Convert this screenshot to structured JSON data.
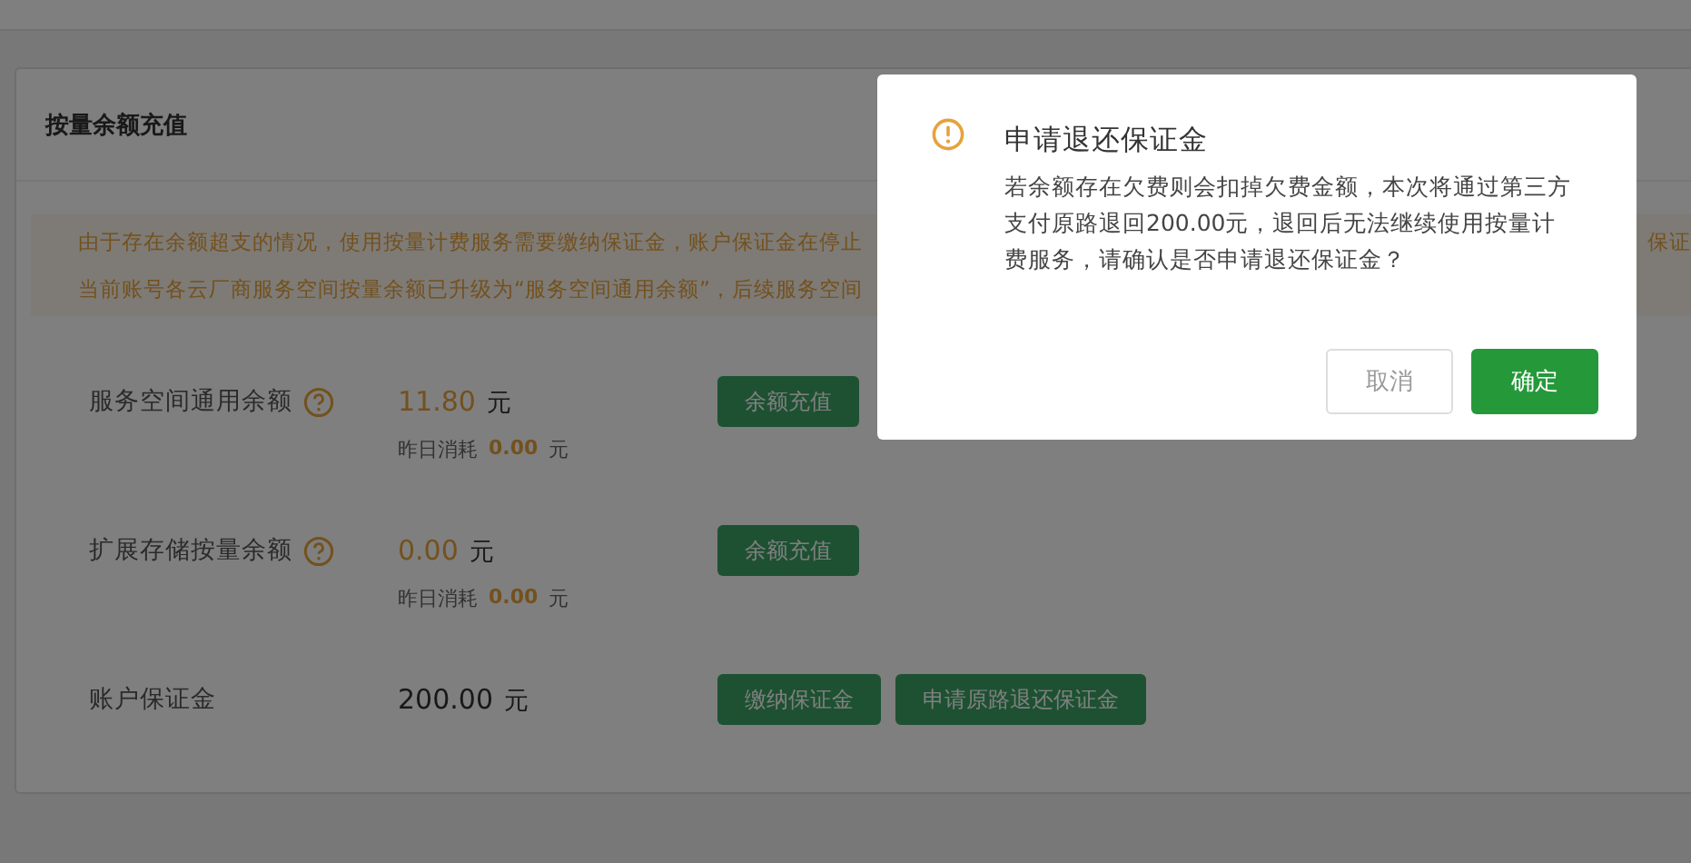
{
  "card": {
    "title": "按量余额充值"
  },
  "notice": {
    "lines": [
      {
        "text": "由于存在余额超支的情况，使用按量计费服务需要缴纳保证金，账户保证金在停止",
        "tail": "保证"
      },
      {
        "text": "当前账号各云厂商服务空间按量余额已升级为“服务空间通用余额”，后续服务空间"
      }
    ]
  },
  "rows": [
    {
      "label": "服务空间通用余额",
      "help": true,
      "amount": "11.80",
      "highlight": true,
      "unit": "元",
      "buttons": [
        "余额充值"
      ],
      "yesterday": {
        "label": "昨日消耗",
        "amount": "0.00",
        "unit": "元"
      }
    },
    {
      "label": "扩展存储按量余额",
      "help": true,
      "amount": "0.00",
      "highlight": true,
      "unit": "元",
      "buttons": [
        "余额充值"
      ],
      "yesterday": {
        "label": "昨日消耗",
        "amount": "0.00",
        "unit": "元"
      }
    },
    {
      "label": "账户保证金",
      "help": false,
      "amount": "200.00",
      "highlight": false,
      "unit": "元",
      "buttons": [
        "缴纳保证金",
        "申请原路退还保证金"
      ]
    }
  ],
  "dialog": {
    "title": "申请退还保证金",
    "message": "若余额存在欠费则会扣掉欠费金额，本次将通过第三方支付原路退回200.00元，退回后无法继续使用按量计费服务，请确认是否申请退还保证金？",
    "cancel": "取消",
    "confirm": "确定"
  }
}
